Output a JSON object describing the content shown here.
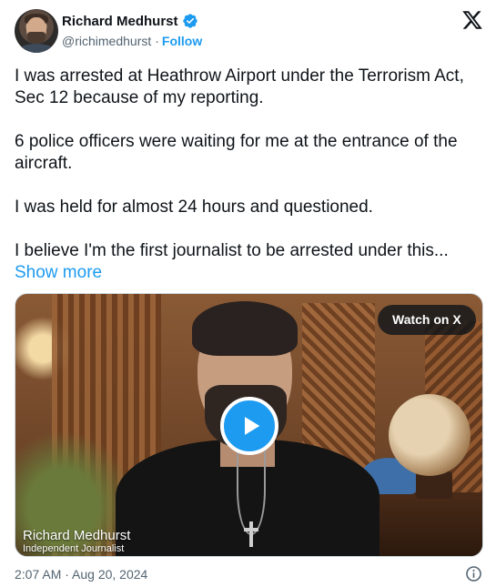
{
  "author": {
    "name": "Richard Medhurst",
    "handle": "@richimedhurst",
    "separator": "·",
    "follow_label": "Follow",
    "verified": true,
    "verified_color": "#1d9bf0"
  },
  "tweet": {
    "paragraphs": [
      "I was arrested at Heathrow Airport under the Terrorism Act, Sec 12 because of my reporting.",
      "6 police officers were waiting for me at the entrance of the aircraft.",
      "I was held for almost 24 hours and questioned.",
      "I believe I'm the first journalist to be arrested under this..."
    ],
    "show_more": "Show more"
  },
  "media": {
    "watch_label": "Watch on X",
    "caption_name": "Richard Medhurst",
    "caption_title": "Independent Journalist",
    "play_icon": "play-icon"
  },
  "footer": {
    "timestamp": "2:07 AM · Aug 20, 2024",
    "info_icon": "info-icon"
  },
  "colors": {
    "accent": "#1d9bf0",
    "text": "#0f1419",
    "secondary": "#536471"
  }
}
